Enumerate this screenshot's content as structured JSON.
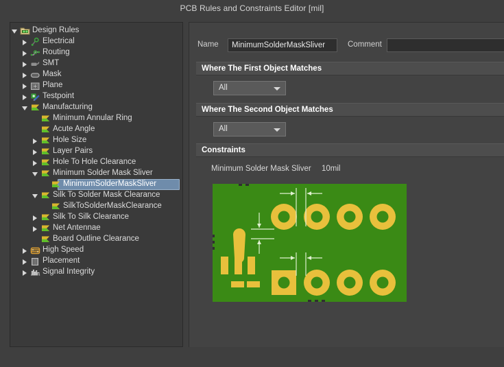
{
  "window": {
    "title": "PCB Rules and Constraints Editor [mil]"
  },
  "tree": {
    "items": [
      {
        "label": "Design Rules",
        "depth": 0,
        "expander": "open",
        "icon": "design-rules-icon",
        "selected": false
      },
      {
        "label": "Electrical",
        "depth": 1,
        "expander": "closed",
        "icon": "electrical-icon",
        "selected": false
      },
      {
        "label": "Routing",
        "depth": 1,
        "expander": "closed",
        "icon": "routing-icon",
        "selected": false
      },
      {
        "label": "SMT",
        "depth": 1,
        "expander": "closed",
        "icon": "smt-icon",
        "selected": false
      },
      {
        "label": "Mask",
        "depth": 1,
        "expander": "closed",
        "icon": "mask-icon",
        "selected": false
      },
      {
        "label": "Plane",
        "depth": 1,
        "expander": "closed",
        "icon": "plane-icon",
        "selected": false
      },
      {
        "label": "Testpoint",
        "depth": 1,
        "expander": "closed",
        "icon": "testpoint-icon",
        "selected": false
      },
      {
        "label": "Manufacturing",
        "depth": 1,
        "expander": "open",
        "icon": "manufacturing-icon",
        "selected": false
      },
      {
        "label": "Minimum Annular Ring",
        "depth": 2,
        "expander": "none",
        "icon": "manufacturing-icon",
        "selected": false
      },
      {
        "label": "Acute Angle",
        "depth": 2,
        "expander": "none",
        "icon": "manufacturing-icon",
        "selected": false
      },
      {
        "label": "Hole Size",
        "depth": 2,
        "expander": "closed",
        "icon": "manufacturing-icon",
        "selected": false
      },
      {
        "label": "Layer Pairs",
        "depth": 2,
        "expander": "closed",
        "icon": "manufacturing-icon",
        "selected": false
      },
      {
        "label": "Hole To Hole Clearance",
        "depth": 2,
        "expander": "closed",
        "icon": "manufacturing-icon",
        "selected": false
      },
      {
        "label": "Minimum Solder Mask Sliver",
        "depth": 2,
        "expander": "open",
        "icon": "manufacturing-icon",
        "selected": false
      },
      {
        "label": "MinimumSolderMaskSliver",
        "depth": 3,
        "expander": "none",
        "icon": "manufacturing-icon",
        "selected": true
      },
      {
        "label": "Silk To Solder Mask Clearance",
        "depth": 2,
        "expander": "open",
        "icon": "manufacturing-icon",
        "selected": false
      },
      {
        "label": "SilkToSolderMaskClearance",
        "depth": 3,
        "expander": "none",
        "icon": "manufacturing-icon",
        "selected": false
      },
      {
        "label": "Silk To Silk Clearance",
        "depth": 2,
        "expander": "closed",
        "icon": "manufacturing-icon",
        "selected": false
      },
      {
        "label": "Net Antennae",
        "depth": 2,
        "expander": "closed",
        "icon": "manufacturing-icon",
        "selected": false
      },
      {
        "label": "Board Outline Clearance",
        "depth": 2,
        "expander": "none",
        "icon": "manufacturing-icon",
        "selected": false
      },
      {
        "label": "High Speed",
        "depth": 1,
        "expander": "closed",
        "icon": "high-speed-icon",
        "selected": false
      },
      {
        "label": "Placement",
        "depth": 1,
        "expander": "closed",
        "icon": "placement-icon",
        "selected": false
      },
      {
        "label": "Signal Integrity",
        "depth": 1,
        "expander": "closed",
        "icon": "signal-integrity-icon",
        "selected": false
      }
    ]
  },
  "editor": {
    "name_label": "Name",
    "name_value": "MinimumSolderMaskSliver",
    "comment_label": "Comment",
    "comment_value": "",
    "first_object_header": "Where The First Object Matches",
    "first_object_scope": "All",
    "second_object_header": "Where The Second Object Matches",
    "second_object_scope": "All",
    "constraints_header": "Constraints",
    "constraint_label": "Minimum Solder Mask Sliver",
    "constraint_value": "10mil"
  },
  "colors": {
    "board_green": "#3a8a15",
    "pad_gold": "#e8c03c",
    "dim_line": "#cfe8c0",
    "selection_blue": "#6f8cab",
    "panel_bg": "#434343",
    "tree_bg": "#3a3a3a",
    "window_bg": "#3f3f3f"
  }
}
